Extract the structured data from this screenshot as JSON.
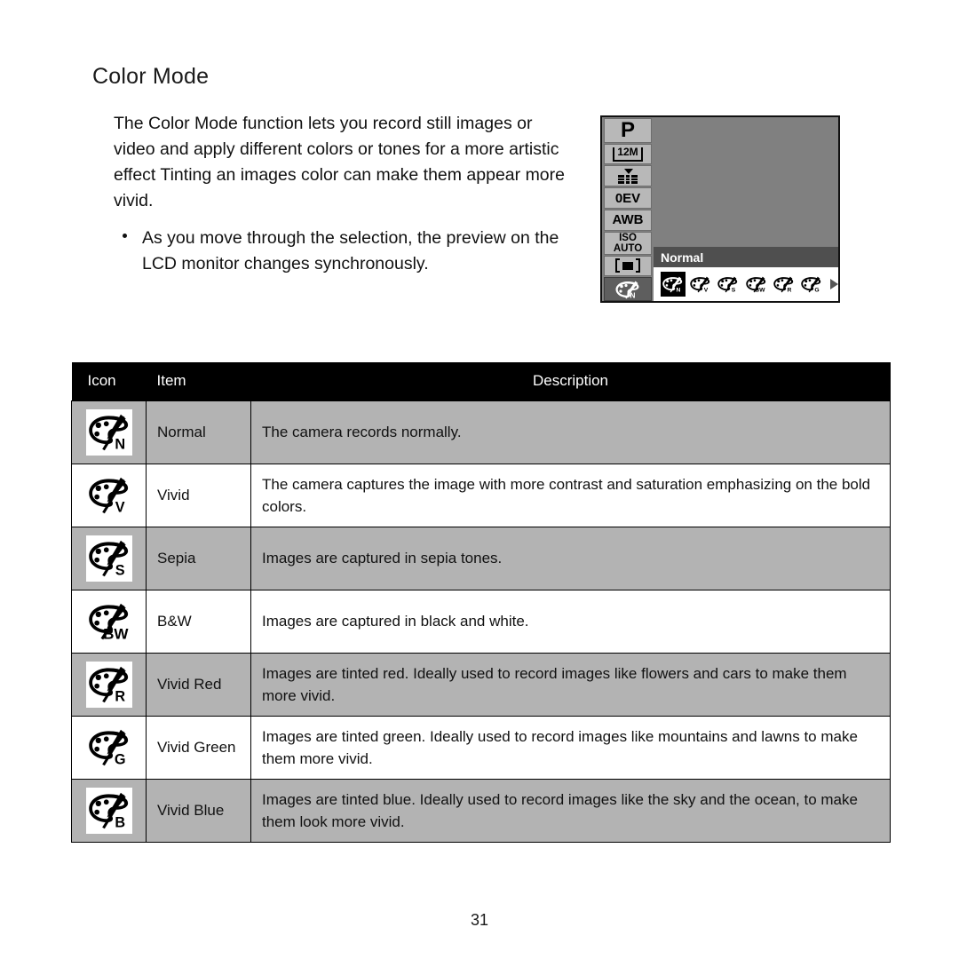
{
  "page": {
    "heading": "Color Mode",
    "number": "31",
    "intro": "The Color Mode function lets you record still images or video and apply different colors or tones for a more artistic effect Tinting an images color can make them appear more vivid.",
    "bullet": "As you move through the selection, the preview on the LCD monitor changes synchronously."
  },
  "lcd": {
    "sidebar": [
      {
        "name": "mode-chip",
        "label": "P"
      },
      {
        "name": "resolution-chip",
        "label": "12M"
      },
      {
        "name": "quality-chip",
        "label": "quality-icon"
      },
      {
        "name": "exposure-chip",
        "label": "0EV"
      },
      {
        "name": "whitebalance-chip",
        "label": "AWB"
      },
      {
        "name": "iso-chip",
        "label": "ISO",
        "label2": "AUTO"
      },
      {
        "name": "metering-chip",
        "label": "metering-icon"
      },
      {
        "name": "colormode-chip",
        "label": "palette-icon",
        "letter": "N"
      }
    ],
    "menu_title": "Normal",
    "menu_icons": [
      {
        "letter": "N",
        "selected": true
      },
      {
        "letter": "V",
        "selected": false
      },
      {
        "letter": "S",
        "selected": false
      },
      {
        "letter": "BW",
        "selected": false
      },
      {
        "letter": "R",
        "selected": false
      },
      {
        "letter": "G",
        "selected": false
      }
    ],
    "more_arrow": "right-arrow-icon"
  },
  "table": {
    "headers": [
      "Icon",
      "Item",
      "Description"
    ],
    "rows": [
      {
        "letter": "N",
        "item": "Normal",
        "description": "The camera records normally.",
        "shade": "gray"
      },
      {
        "letter": "V",
        "item": "Vivid",
        "description": "The camera captures the image with more contrast and saturation emphasizing on the bold colors.",
        "shade": "white"
      },
      {
        "letter": "S",
        "item": "Sepia",
        "description": "Images are captured in sepia tones.",
        "shade": "gray"
      },
      {
        "letter": "BW",
        "item": "B&W",
        "description": "Images are captured in black and white.",
        "shade": "white"
      },
      {
        "letter": "R",
        "item": "Vivid Red",
        "description": "Images are tinted red. Ideally used to record images like flowers and cars to make them more vivid.",
        "shade": "gray"
      },
      {
        "letter": "G",
        "item": "Vivid Green",
        "description": "Images are tinted green. Ideally used to record images like mountains and lawns to make them more vivid.",
        "shade": "white"
      },
      {
        "letter": "B",
        "item": "Vivid Blue",
        "description": "Images are tinted blue. Ideally used to record images like the sky and the ocean, to make them look more vivid.",
        "shade": "gray"
      }
    ]
  },
  "colors": {
    "row_gray": "#b3b3b3",
    "header_black": "#000000",
    "lcd_gray": "#808080",
    "chip_gray": "#b8b8b8",
    "menu_title_gray": "#4f4f4f"
  }
}
